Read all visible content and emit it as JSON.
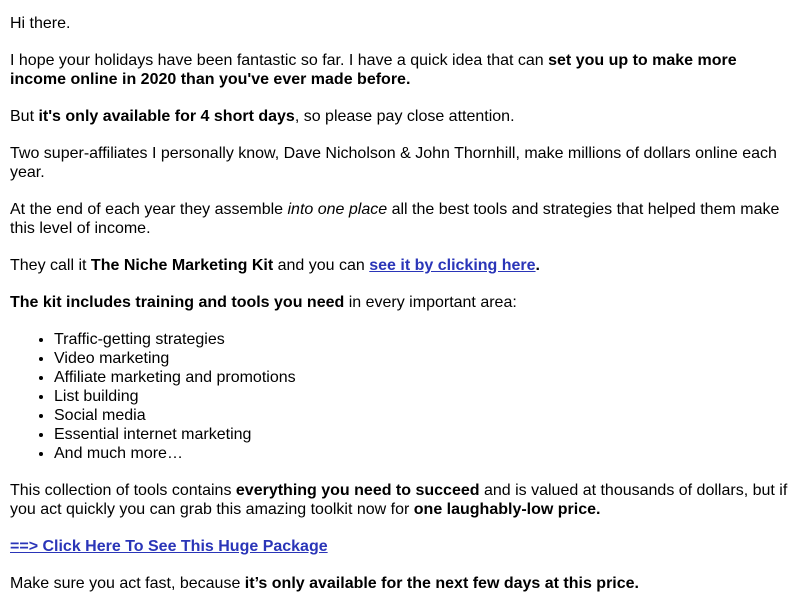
{
  "email": {
    "greeting": "Hi there.",
    "p1": {
      "t1": "I hope your holidays have been fantastic so far. I have a quick idea that can ",
      "b1": "set you up to make more income online in 2020 than you've ever made before."
    },
    "p2": {
      "t1": "But ",
      "b1": "it's only available for 4 short days",
      "t2": ", so please pay close attention."
    },
    "p3": "Two super-affiliates I personally know, Dave Nicholson & John Thornhill, make millions of dollars online each year.",
    "p4": {
      "t1": "At the end of each year they assemble ",
      "i1": "into one place",
      "t2": " all the best tools and strategies that helped them make this level of income."
    },
    "p5": {
      "t1": "They call it ",
      "b1": "The Niche Marketing Kit",
      "t2": " and you can ",
      "link": "see it by clicking here",
      "t3": "."
    },
    "p6": {
      "b1": "The kit includes training and tools you need",
      "t1": " in every important area:"
    },
    "list": [
      "Traffic-getting strategies",
      "Video marketing",
      "Affiliate marketing and promotions",
      "List building",
      "Social media",
      "Essential internet marketing",
      "And much more…"
    ],
    "p7": {
      "t1": "This collection of tools contains ",
      "b1": "everything you need to succeed",
      "t2": " and is valued at thousands of dollars, but if you act quickly you can grab this amazing toolkit now for ",
      "b2": "one laughably-low price."
    },
    "cta_link": "==> Click Here To See This Huge Package",
    "p8": {
      "t1": "Make sure you act fast, because ",
      "b1": "it’s only available for the next few days at this price."
    },
    "colors": {
      "link": "#2a35b8",
      "text": "#000000",
      "background": "#ffffff"
    }
  }
}
